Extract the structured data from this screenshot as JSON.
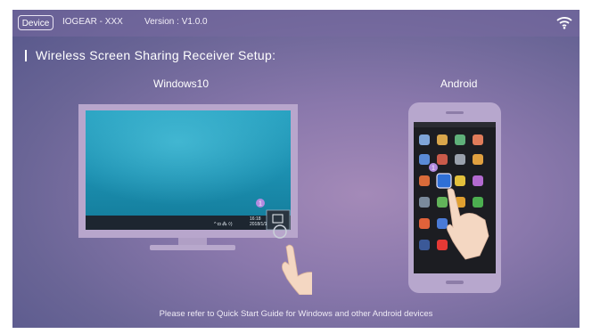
{
  "header": {
    "device_button": "Device",
    "device_name": "IOGEAR - XXX",
    "version": "Version : V1.0.0"
  },
  "setup_title": "Wireless Screen Sharing Receiver Setup:",
  "windows": {
    "label": "Windows10",
    "clock_time": "16:18",
    "clock_date": "2018/1/1",
    "step_badge": "1"
  },
  "android": {
    "label": "Android",
    "step_badge": "1"
  },
  "footer": "Please refer to Quick Start Guide for Windows and other Android devices",
  "colors": {
    "badge": "#b38be0",
    "desktop": "#1d93b3",
    "frame": "#b8a6cc"
  }
}
